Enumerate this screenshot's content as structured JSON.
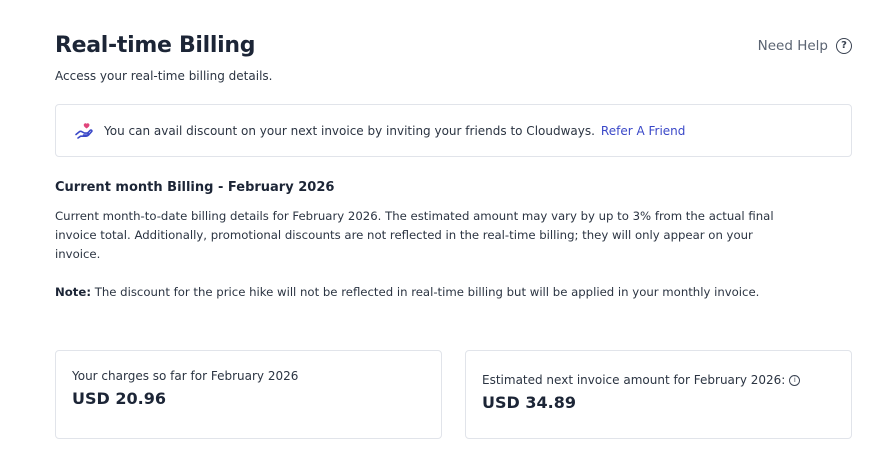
{
  "header": {
    "title": "Real-time Billing",
    "subtitle": "Access your real-time billing details.",
    "help_label": "Need Help",
    "help_icon_glyph": "?"
  },
  "referral": {
    "icon": "hand-heart-icon",
    "text": "You can avail discount on your next invoice by inviting your friends to Cloudways.",
    "link_label": "Refer A Friend",
    "link_color": "#3a48c8"
  },
  "billing": {
    "title": "Current month Billing - February 2026",
    "description": "Current month-to-date billing details for February 2026. The estimated amount may vary by up to 3% from the actual final invoice total. Additionally, promotional discounts are not reflected in the real-time billing; they will only appear on your invoice.",
    "note_label": "Note:",
    "note_text": " The discount for the price hike will not be reflected in real-time billing but will be applied in your monthly invoice."
  },
  "cards": {
    "charges_label": "Your charges so far for February 2026",
    "charges_value": "USD 20.96",
    "estimate_label": "Estimated next invoice amount for February 2026:",
    "estimate_info_icon": "i",
    "estimate_value": "USD 34.89"
  }
}
